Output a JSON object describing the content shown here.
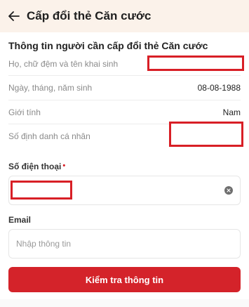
{
  "header": {
    "back_icon": "arrow-left-icon",
    "title": "Cấp đổi thẻ Căn cước"
  },
  "section": {
    "title": "Thông tin người cần cấp đổi thẻ Căn cước"
  },
  "info_rows": [
    {
      "label": "Họ, chữ đệm và tên khai sinh",
      "value": ""
    },
    {
      "label": "Ngày, tháng, năm sinh",
      "value": "08-08-1988"
    },
    {
      "label": "Giới tính",
      "value": "Nam"
    },
    {
      "label": "Số định danh cá nhân",
      "value": ""
    }
  ],
  "phone": {
    "label": "Số điện thoại",
    "required_mark": "•",
    "value": "",
    "clear_icon": "clear-circle-icon"
  },
  "email": {
    "label": "Email",
    "placeholder": "Nhập thông tin",
    "value": ""
  },
  "submit": {
    "label": "Kiểm tra thông tin"
  },
  "colors": {
    "header_bg": "#fbf2ea",
    "primary": "#d4232a",
    "redaction": "#d81f26"
  }
}
